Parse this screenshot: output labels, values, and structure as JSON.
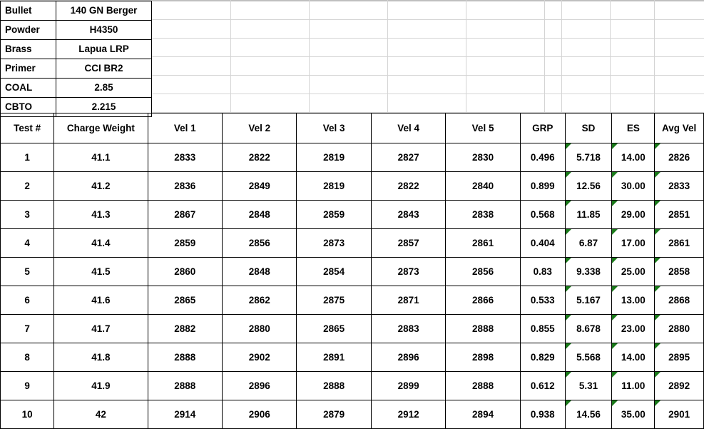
{
  "info": {
    "rows": [
      {
        "label": "Bullet",
        "value": "140 GN Berger"
      },
      {
        "label": "Powder",
        "value": "H4350"
      },
      {
        "label": "Brass",
        "value": "Lapua LRP"
      },
      {
        "label": "Primer",
        "value": "CCI BR2"
      },
      {
        "label": "COAL",
        "value": "2.85"
      },
      {
        "label": "CBTO",
        "value": "2.215"
      }
    ]
  },
  "table": {
    "headers": [
      "Test #",
      "Charge Weight",
      "Vel 1",
      "Vel 2",
      "Vel 3",
      "Vel 4",
      "Vel 5",
      "GRP",
      "SD",
      "ES",
      "Avg Vel"
    ],
    "rows": [
      {
        "test": "1",
        "charge": "41.1",
        "vel1": "2833",
        "vel2": "2822",
        "vel3": "2819",
        "vel4": "2827",
        "vel5": "2830",
        "grp": "0.496",
        "sd": "5.718",
        "es": "14.00",
        "avg": "2826"
      },
      {
        "test": "2",
        "charge": "41.2",
        "vel1": "2836",
        "vel2": "2849",
        "vel3": "2819",
        "vel4": "2822",
        "vel5": "2840",
        "grp": "0.899",
        "sd": "12.56",
        "es": "30.00",
        "avg": "2833"
      },
      {
        "test": "3",
        "charge": "41.3",
        "vel1": "2867",
        "vel2": "2848",
        "vel3": "2859",
        "vel4": "2843",
        "vel5": "2838",
        "grp": "0.568",
        "sd": "11.85",
        "es": "29.00",
        "avg": "2851"
      },
      {
        "test": "4",
        "charge": "41.4",
        "vel1": "2859",
        "vel2": "2856",
        "vel3": "2873",
        "vel4": "2857",
        "vel5": "2861",
        "grp": "0.404",
        "sd": "6.87",
        "es": "17.00",
        "avg": "2861"
      },
      {
        "test": "5",
        "charge": "41.5",
        "vel1": "2860",
        "vel2": "2848",
        "vel3": "2854",
        "vel4": "2873",
        "vel5": "2856",
        "grp": "0.83",
        "sd": "9.338",
        "es": "25.00",
        "avg": "2858"
      },
      {
        "test": "6",
        "charge": "41.6",
        "vel1": "2865",
        "vel2": "2862",
        "vel3": "2875",
        "vel4": "2871",
        "vel5": "2866",
        "grp": "0.533",
        "sd": "5.167",
        "es": "13.00",
        "avg": "2868"
      },
      {
        "test": "7",
        "charge": "41.7",
        "vel1": "2882",
        "vel2": "2880",
        "vel3": "2865",
        "vel4": "2883",
        "vel5": "2888",
        "grp": "0.855",
        "sd": "8.678",
        "es": "23.00",
        "avg": "2880"
      },
      {
        "test": "8",
        "charge": "41.8",
        "vel1": "2888",
        "vel2": "2902",
        "vel3": "2891",
        "vel4": "2896",
        "vel5": "2898",
        "grp": "0.829",
        "sd": "5.568",
        "es": "14.00",
        "avg": "2895"
      },
      {
        "test": "9",
        "charge": "41.9",
        "vel1": "2888",
        "vel2": "2896",
        "vel3": "2888",
        "vel4": "2899",
        "vel5": "2888",
        "grp": "0.612",
        "sd": "5.31",
        "es": "11.00",
        "avg": "2892"
      },
      {
        "test": "10",
        "charge": "42",
        "vel1": "2914",
        "vel2": "2906",
        "vel3": "2879",
        "vel4": "2912",
        "vel5": "2894",
        "grp": "0.938",
        "sd": "14.56",
        "es": "35.00",
        "avg": "2901"
      }
    ]
  },
  "style": {
    "border_color": "#000000",
    "gridline_color": "#d4d4d4",
    "flag_color": "#1a7a1a",
    "background": "#ffffff"
  }
}
